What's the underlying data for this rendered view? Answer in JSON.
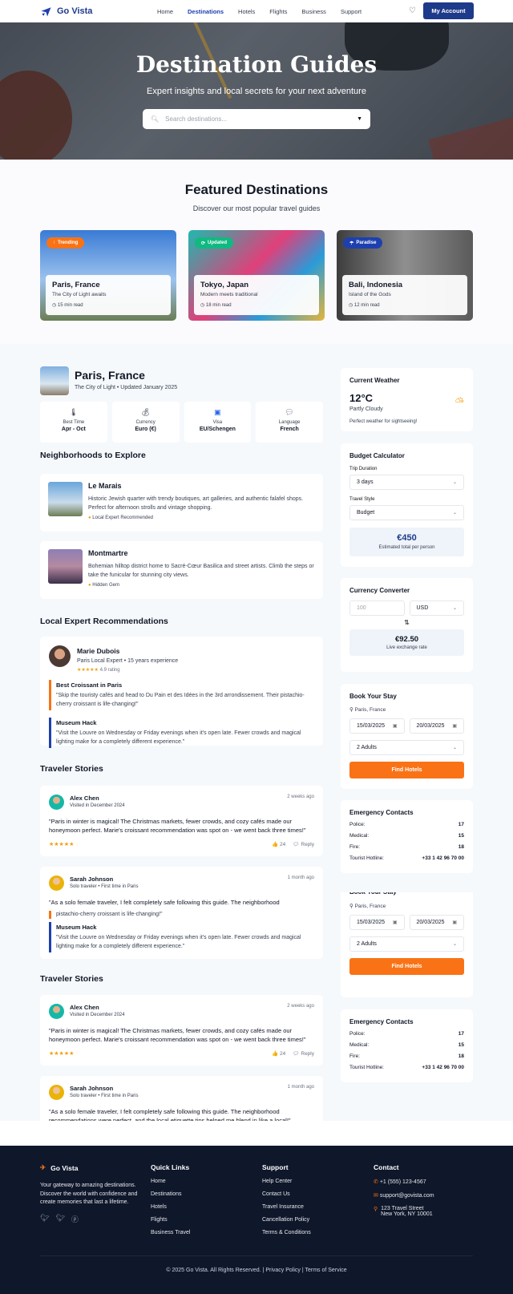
{
  "nav": {
    "brand": "Go Vista",
    "items": [
      "Home",
      "Destinations",
      "Hotels",
      "Flights",
      "Business",
      "Support"
    ],
    "active": "Destinations",
    "account": "My Account"
  },
  "hero": {
    "title": "Destination Guides",
    "subtitle": "Expert insights and local secrets for your next adventure",
    "search_placeholder": "Search destinations..."
  },
  "featured": {
    "title": "Featured Destinations",
    "subtitle": "Discover our most popular travel guides",
    "cards": [
      {
        "badge": "Trending",
        "name": "Paris, France",
        "desc": "The City of Light awaits",
        "read": "15 min read"
      },
      {
        "badge": "Updated",
        "name": "Tokyo, Japan",
        "desc": "Modern meets traditional",
        "read": "18 min read"
      },
      {
        "badge": "Paradise",
        "name": "Bali, Indonesia",
        "desc": "Island of the Gods",
        "read": "12 min read"
      }
    ]
  },
  "guide": {
    "name": "Paris, France",
    "sub": "The City of Light • Updated January 2025",
    "facts": [
      {
        "label": "Best Time",
        "value": "Apr - Oct"
      },
      {
        "label": "Currency",
        "value": "Euro (€)"
      },
      {
        "label": "Visa",
        "value": "EU/Schengen"
      },
      {
        "label": "Language",
        "value": "French"
      }
    ]
  },
  "neighborhoods": {
    "title": "Neighborhoods to Explore",
    "items": [
      {
        "name": "Le Marais",
        "desc": "Historic Jewish quarter with trendy boutiques, art galleries, and authentic falafel shops. Perfect for afternoon strolls and vintage shopping.",
        "tag": "Local Expert Recommended"
      },
      {
        "name": "Montmartre",
        "desc": "Bohemian hilltop district home to Sacré-Cœur Basilica and street artists. Climb the steps or take the funicular for stunning city views.",
        "tag": "Hidden Gem"
      }
    ]
  },
  "experts": {
    "title": "Local Expert Recommendations",
    "name": "Marie Dubois",
    "role": "Paris Local Expert • 15 years experience",
    "stars": "★★★★★",
    "rating": "4.9 rating",
    "tips": [
      {
        "title": "Best Croissant in Paris",
        "text": "\"Skip the touristy cafés and head to Du Pain et des Idées in the 3rd arrondissement. Their pistachio-cherry croissant is life-changing!\""
      },
      {
        "title": "Museum Hack",
        "text": "\"Visit the Louvre on Wednesday or Friday evenings when it's open late. Fewer crowds and magical lighting make for a completely different experience.\""
      }
    ],
    "ghost_tip": "pistachio-cherry croissant is life-changing!\""
  },
  "stories": {
    "title": "Traveler Stories",
    "items": [
      {
        "name": "Alex Chen",
        "meta": "Visited in December 2024",
        "ago": "2 weeks ago",
        "text": "\"Paris in winter is magical! The Christmas markets, fewer crowds, and cozy cafés made our honeymoon perfect. Marie's croissant recommendation was spot on - we went back three times!\"",
        "stars": "★★★★★",
        "likes": "👍 24",
        "reply": "Reply"
      },
      {
        "name": "Sarah Johnson",
        "meta": "Solo traveler • First time in Paris",
        "ago": "1 month ago",
        "text": "\"As a solo female traveler, I felt completely safe following this guide. The neighborhood recommendations were perfect, and the local etiquette tips helped me blend in like a local!\""
      }
    ]
  },
  "weather": {
    "title": "Current Weather",
    "temp": "12°C",
    "cond": "Partly Cloudy",
    "note": "Perfect weather for sightseeing!"
  },
  "budget": {
    "title": "Budget Calculator",
    "duration_label": "Trip Duration",
    "duration": "3 days",
    "style_label": "Travel Style",
    "style": "Budget",
    "total": "€450",
    "total_label": "Estimated total per person"
  },
  "currency": {
    "title": "Currency Converter",
    "amount_placeholder": "100",
    "currency": "USD",
    "result": "€92.50",
    "result_label": "Live exchange rate"
  },
  "stay": {
    "title": "Book Your Stay",
    "partial_title": "Book Your Stay",
    "location": "Paris, France",
    "checkin": "15/03/2025",
    "checkout": "20/03/2025",
    "guests": "2 Adults",
    "button": "Find Hotels"
  },
  "emergency": {
    "title": "Emergency Contacts",
    "rows": [
      {
        "k": "Police:",
        "v": "17"
      },
      {
        "k": "Medical:",
        "v": "15"
      },
      {
        "k": "Fire:",
        "v": "18"
      },
      {
        "k": "Tourist Hotline:",
        "v": "+33 1 42 96 70 00"
      }
    ]
  },
  "footer": {
    "brand": "Go Vista",
    "about": "Your gateway to amazing destinations. Discover the world with confidence and create memories that last a lifetime.",
    "quick_title": "Quick Links",
    "quick": [
      "Home",
      "Destinations",
      "Hotels",
      "Flights",
      "Business Travel"
    ],
    "support_title": "Support",
    "support": [
      "Help Center",
      "Contact Us",
      "Travel Insurance",
      "Cancellation Policy",
      "Terms & Conditions"
    ],
    "contact_title": "Contact",
    "phone": "+1 (555) 123-4567",
    "email": "support@govista.com",
    "address1": "123 Travel Street",
    "address2": "New York, NY 10001",
    "copyright": "© 2025 Go Vista. All Rights Reserved. | Privacy Policy | Terms of Service"
  }
}
